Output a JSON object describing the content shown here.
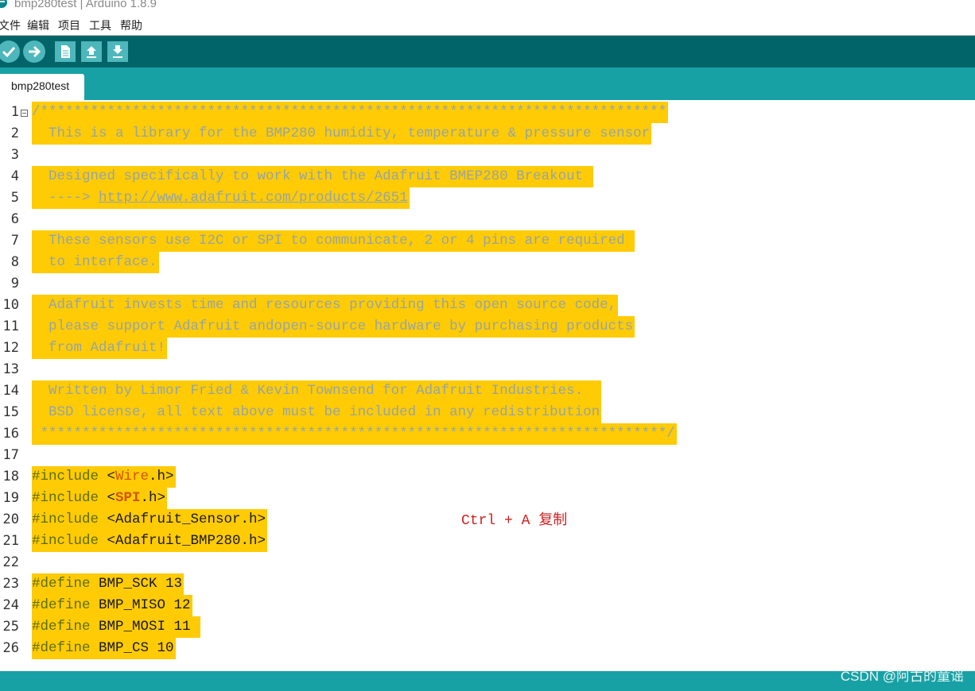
{
  "window": {
    "title": "bmp280test | Arduino 1.8.9"
  },
  "menu": [
    "文件",
    "编辑",
    "项目",
    "工具",
    "帮助"
  ],
  "toolbar": {
    "buttons": [
      "verify-button",
      "upload-button",
      "new-button",
      "open-button",
      "save-button"
    ],
    "colors": {
      "background": "#006468",
      "button": "#4db7bb"
    }
  },
  "tabs": [
    {
      "label": "bmp280test"
    }
  ],
  "editor": {
    "lines": [
      {
        "n": "1",
        "text": "/***************************************************************************"
      },
      {
        "n": "2",
        "text": "  This is a library for the BMP280 humidity, temperature & pressure sensor"
      },
      {
        "n": "3",
        "text": ""
      },
      {
        "n": "4",
        "text": "  Designed specifically to work with the Adafruit BMEP280 Breakout "
      },
      {
        "n": "5",
        "text_pre": "  ----> ",
        "url": "http://www.adafruit.com/products/2651"
      },
      {
        "n": "6",
        "text": ""
      },
      {
        "n": "7",
        "text": "  These sensors use I2C or SPI to communicate, 2 or 4 pins are required "
      },
      {
        "n": "8",
        "text": "  to interface."
      },
      {
        "n": "9",
        "text": ""
      },
      {
        "n": "10",
        "text": "  Adafruit invests time and resources providing this open source code,"
      },
      {
        "n": "11",
        "text": "  please support Adafruit andopen-source hardware by purchasing products"
      },
      {
        "n": "12",
        "text": "  from Adafruit!"
      },
      {
        "n": "13",
        "text": ""
      },
      {
        "n": "14",
        "text": "  Written by Limor Fried & Kevin Townsend for Adafruit Industries.  "
      },
      {
        "n": "15",
        "text": "  BSD license, all text above must be included in any redistribution"
      },
      {
        "n": "16",
        "text": " ***************************************************************************/"
      },
      {
        "n": "17",
        "text": ""
      },
      {
        "n": "18",
        "kw": "#include",
        "open": " <",
        "lib": "Wire",
        "libstyle": "lib1",
        "close": ".h>"
      },
      {
        "n": "19",
        "kw": "#include",
        "open": " <",
        "lib": "SPI",
        "libstyle": "lib2",
        "close": ".h>"
      },
      {
        "n": "20",
        "kw": "#include",
        "rest": " <Adafruit_Sensor.h>"
      },
      {
        "n": "21",
        "kw": "#include",
        "rest": " <Adafruit_BMP280.h>"
      },
      {
        "n": "22",
        "text": ""
      },
      {
        "n": "23",
        "kw": "#define",
        "rest": " BMP_SCK 13"
      },
      {
        "n": "24",
        "kw": "#define",
        "rest": " BMP_MISO 12"
      },
      {
        "n": "25",
        "kw": "#define",
        "rest": " BMP_MOSI 11 "
      },
      {
        "n": "26",
        "kw": "#define",
        "rest": " BMP_CS 10"
      }
    ],
    "selection_color": "#ffcb05",
    "comment_color": "#95a5a6"
  },
  "annotation": "Ctrl + A 复制",
  "watermark": "CSDN @阿古的童谣"
}
